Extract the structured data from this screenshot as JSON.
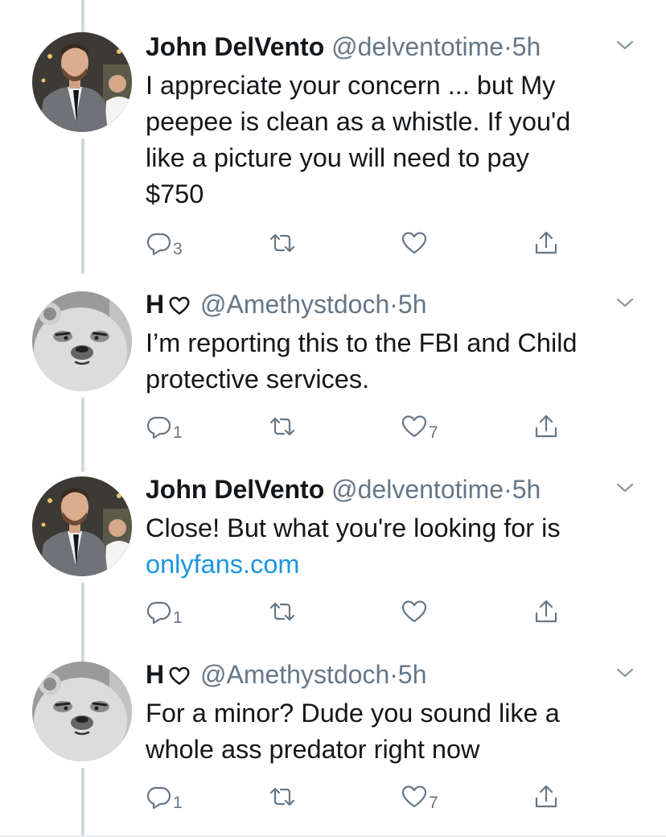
{
  "tweets": [
    {
      "name": "John DelVento",
      "heart_in_name": false,
      "handle": "@delventotime",
      "dot": "·",
      "time": "5h",
      "lines": [
        "I appreciate your concern ... but My",
        "peepee is clean as a whistle.  If you'd",
        "like a picture you will need to pay",
        "$750"
      ],
      "link": "",
      "reply_count": "3",
      "retweet_count": "",
      "like_count": ""
    },
    {
      "name": "H",
      "heart_in_name": true,
      "handle": "@Amethystdoch",
      "dot": "·",
      "time": "5h",
      "lines": [
        "I’m reporting this to the FBI and Child",
        "protective services."
      ],
      "link": "",
      "reply_count": "1",
      "retweet_count": "",
      "like_count": "7"
    },
    {
      "name": "John DelVento",
      "heart_in_name": false,
      "handle": "@delventotime",
      "dot": "·",
      "time": "5h",
      "lines": [
        "Close!  But what you're looking for is"
      ],
      "link": "onlyfans.com",
      "reply_count": "1",
      "retweet_count": "",
      "like_count": ""
    },
    {
      "name": "H",
      "heart_in_name": true,
      "handle": "@Amethystdoch",
      "dot": "·",
      "time": "5h",
      "lines": [
        "For a minor? Dude you sound like a",
        "whole ass predator right now"
      ],
      "link": "",
      "reply_count": "1",
      "retweet_count": "",
      "like_count": "7"
    }
  ],
  "icons": {
    "reply": "reply-icon",
    "retweet": "retweet-icon",
    "like": "heart-icon",
    "share": "share-icon",
    "more": "chevron-down-icon"
  },
  "colors": {
    "text": "#14171a",
    "secondary": "#657786",
    "link": "#1b95e0",
    "thread_line": "#cfd9de"
  }
}
